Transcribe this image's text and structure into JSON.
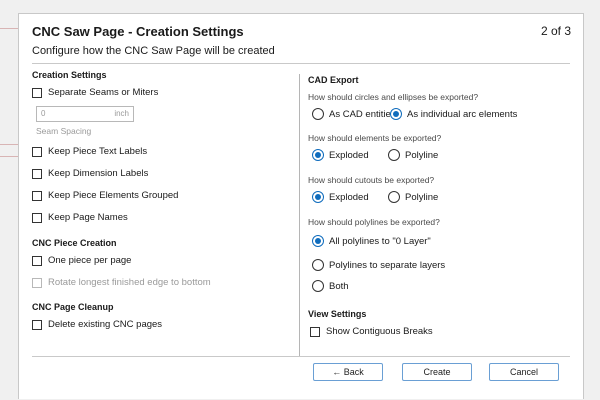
{
  "dialog": {
    "title": "CNC Saw Page - Creation Settings",
    "page_indicator": "2 of 3",
    "subtitle": "Configure how the CNC Saw Page will be created"
  },
  "left": {
    "creation_settings": {
      "heading": "Creation Settings",
      "separate_seams": {
        "label": "Separate Seams or Miters",
        "checked": false
      },
      "seam_spacing": {
        "value": "0",
        "unit": "inch",
        "caption": "Seam Spacing",
        "disabled": true
      },
      "keep_piece_text": {
        "label": "Keep Piece Text Labels",
        "checked": false
      },
      "keep_dimension": {
        "label": "Keep Dimension Labels",
        "checked": false
      },
      "keep_grouped": {
        "label": "Keep Piece Elements Grouped",
        "checked": false
      },
      "keep_page_names": {
        "label": "Keep Page Names",
        "checked": false
      }
    },
    "piece_creation": {
      "heading": "CNC Piece Creation",
      "one_piece": {
        "label": "One piece per page",
        "checked": false
      },
      "rotate_longest": {
        "label": "Rotate longest finished edge to bottom",
        "checked": false,
        "disabled": true
      }
    },
    "page_cleanup": {
      "heading": "CNC Page Cleanup",
      "delete_existing": {
        "label": "Delete existing CNC pages",
        "checked": false
      }
    }
  },
  "right": {
    "cad_export": {
      "heading": "CAD Export",
      "circles_q": "How should circles and ellipses be exported?",
      "circles_opt1": "As CAD entities",
      "circles_opt2": "As individual arc elements",
      "circles_selected": "As individual arc elements",
      "elements_q": "How should elements be exported?",
      "elements_opt1": "Exploded",
      "elements_opt2": "Polyline",
      "elements_selected": "Exploded",
      "cutouts_q": "How should cutouts be exported?",
      "cutouts_opt1": "Exploded",
      "cutouts_opt2": "Polyline",
      "cutouts_selected": "Exploded",
      "polylines_q": "How should polylines be exported?",
      "polylines_opt1": "All polylines to \"0 Layer\"",
      "polylines_opt2": "Polylines to separate layers",
      "polylines_opt3": "Both",
      "polylines_selected": "All polylines to \"0 Layer\""
    },
    "view_settings": {
      "heading": "View Settings",
      "contiguous": {
        "label": "Show Contiguous Breaks",
        "checked": false
      }
    }
  },
  "buttons": {
    "back": "← Back",
    "create": "Create",
    "cancel": "Cancel"
  },
  "colors": {
    "accent": "#0f6cbd",
    "button_border": "#6a9fd4"
  }
}
